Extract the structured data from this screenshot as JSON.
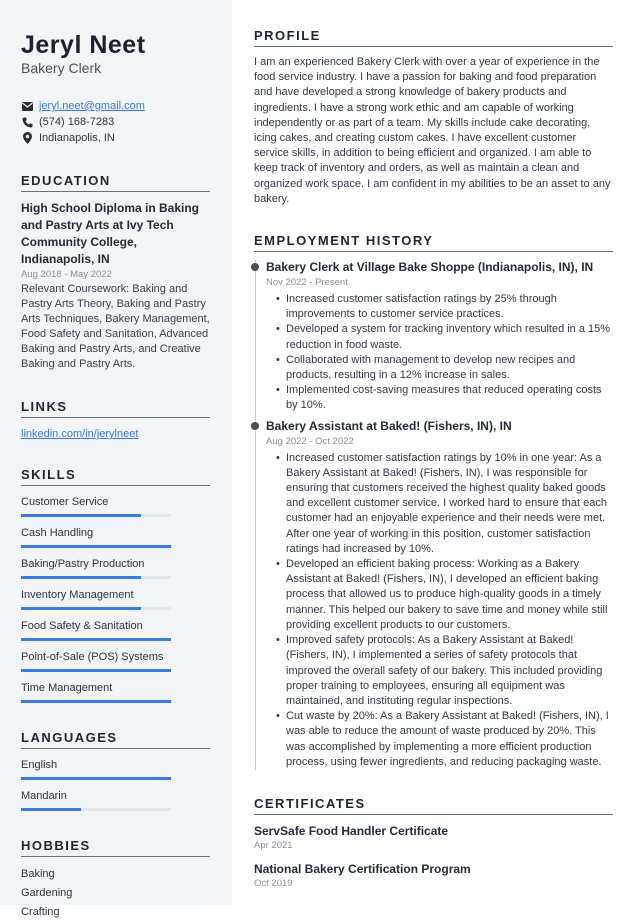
{
  "header": {
    "name": "Jeryl Neet",
    "role": "Bakery Clerk",
    "email": "jeryl.neet@gmail.com",
    "phone": "(574) 168-7283",
    "location": "Indianapolis, IN",
    "icons": [
      "envelope-icon",
      "phone-icon",
      "map-pin-icon"
    ]
  },
  "education": {
    "title": "EDUCATION",
    "degree": "High School Diploma in Baking and Pastry Arts at Ivy Tech Community College, Indianapolis, IN",
    "date": "Aug 2018 - May 2022",
    "description": "Relevant Coursework: Baking and Pastry Arts Theory, Baking and Pastry Arts Techniques, Bakery Management, Food Safety and Sanitation, Advanced Baking and Pastry Arts, and Creative Baking and Pastry Arts."
  },
  "links": {
    "title": "LINKS",
    "items": [
      "linkedin.com/in/jerylneet"
    ]
  },
  "skills": {
    "title": "SKILLS",
    "items": [
      {
        "label": "Customer Service",
        "level": 0.8
      },
      {
        "label": "Cash Handling",
        "level": 1.0
      },
      {
        "label": "Baking/Pastry Production",
        "level": 0.8
      },
      {
        "label": "Inventory Management",
        "level": 0.8
      },
      {
        "label": "Food Safety & Sanitation",
        "level": 1.0
      },
      {
        "label": "Point-of-Sale (POS) Systems",
        "level": 1.0
      },
      {
        "label": "Time Management",
        "level": 1.0
      }
    ]
  },
  "languages": {
    "title": "LANGUAGES",
    "items": [
      {
        "label": "English",
        "level": 1.0
      },
      {
        "label": "Mandarin",
        "level": 0.4
      }
    ]
  },
  "hobbies": {
    "title": "HOBBIES",
    "items": [
      "Baking",
      "Gardening",
      "Crafting"
    ]
  },
  "profile": {
    "title": "PROFILE",
    "text": "I am an experienced Bakery Clerk with over a year of experience in the food service industry. I have a passion for baking and food preparation and have developed a strong knowledge of bakery products and ingredients. I have a strong work ethic and am capable of working independently or as part of a team. My skills include cake decorating, icing cakes, and creating custom cakes. I have excellent customer service skills, in addition to being efficient and organized. I am able to keep track of inventory and orders, as well as maintain a clean and organized work space. I am confident in my abilities to be an asset to any bakery."
  },
  "employment": {
    "title": "EMPLOYMENT HISTORY",
    "jobs": [
      {
        "title": "Bakery Clerk at Village Bake Shoppe (Indianapolis, IN), IN",
        "date": "Nov 2022 - Present",
        "bullets": [
          "Increased customer satisfaction ratings by 25% through improvements to customer service practices.",
          "Developed a system for tracking inventory which resulted in a 15% reduction in food waste.",
          "Collaborated with management to develop new recipes and products, resulting in a 12% increase in sales.",
          "Implemented cost-saving measures that reduced operating costs by 10%."
        ]
      },
      {
        "title": "Bakery Assistant at Baked! (Fishers, IN), IN",
        "date": "Aug 2022 - Oct 2022",
        "bullets": [
          "Increased customer satisfaction ratings by 10% in one year: As a Bakery Assistant at Baked! (Fishers, IN), I was responsible for ensuring that customers received the highest quality baked goods and excellent customer service. I worked hard to ensure that each customer had an enjoyable experience and their needs were met. After one year of working in this position, customer satisfaction ratings had increased by 10%.",
          "Developed an efficient baking process: Working as a Bakery Assistant at Baked! (Fishers, IN), I developed an efficient baking process that allowed us to produce high-quality goods in a timely manner. This helped our bakery to save time and money while still providing excellent products to our customers.",
          "Improved safety protocols: As a Bakery Assistant at Baked! (Fishers, IN), I implemented a series of safety protocols that improved the overall safety of our bakery. This included providing proper training to employees, ensuring all equipment was maintained, and instituting regular inspections.",
          "Cut waste by 20%: As a Bakery Assistant at Baked! (Fishers, IN), I was able to reduce the amount of waste produced by 20%. This was accomplished by implementing a more efficient production process, using fewer ingredients, and reducing packaging waste."
        ]
      }
    ]
  },
  "certificates": {
    "title": "CERTIFICATES",
    "items": [
      {
        "name": "ServSafe Food Handler Certificate",
        "date": "Apr 2021"
      },
      {
        "name": "National Bakery Certification Program",
        "date": "Oct 2019"
      }
    ]
  },
  "colors": {
    "accent": "#3b7de2",
    "sidebar_bg": "#f3f4f6",
    "link": "#3b78d8"
  }
}
